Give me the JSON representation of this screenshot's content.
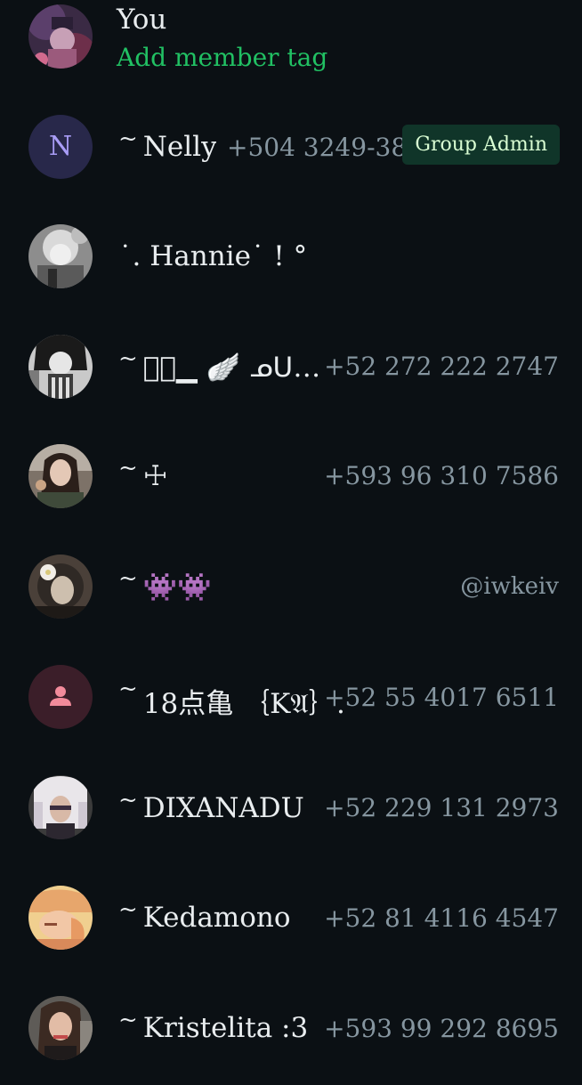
{
  "self": {
    "name": "You",
    "action": "Add member tag"
  },
  "members": [
    {
      "prefix": "~",
      "name": "Nelly",
      "phone": "+504 3249-3809",
      "badge": "Group Admin",
      "avatar_initial": "N"
    },
    {
      "prefix": "",
      "name": "˙. Hannie˙ ! °",
      "phone": ""
    },
    {
      "prefix": "~",
      "name": "㈥ᷓ▁ 🪽 ᓄᑌ…",
      "phone": "+52 272 222 2747"
    },
    {
      "prefix": "~",
      "name": "☩",
      "phone": "+593 96 310 7586"
    },
    {
      "prefix": "~",
      "name": "👾👾",
      "phone": "@iwkeiv"
    },
    {
      "prefix": "~",
      "name": "18点亀 ｛K𝔄｝…",
      "phone": "+52 55 4017 6511",
      "avatar_icon": "person-icon"
    },
    {
      "prefix": "~",
      "name": "DIXANADU",
      "phone": "+52 229 131 2973"
    },
    {
      "prefix": "~",
      "name": "Kedamono",
      "phone": "+52 81 4116 4547"
    },
    {
      "prefix": "~",
      "name": "Kristelita :3",
      "phone": "+593 99 292 8695"
    }
  ],
  "colors": {
    "background": "#0b1014",
    "primary_text": "#e9edef",
    "secondary_text": "#8696a0",
    "accent_green": "#21c063",
    "badge_bg": "#103529",
    "badge_text": "#d9fdd3"
  }
}
